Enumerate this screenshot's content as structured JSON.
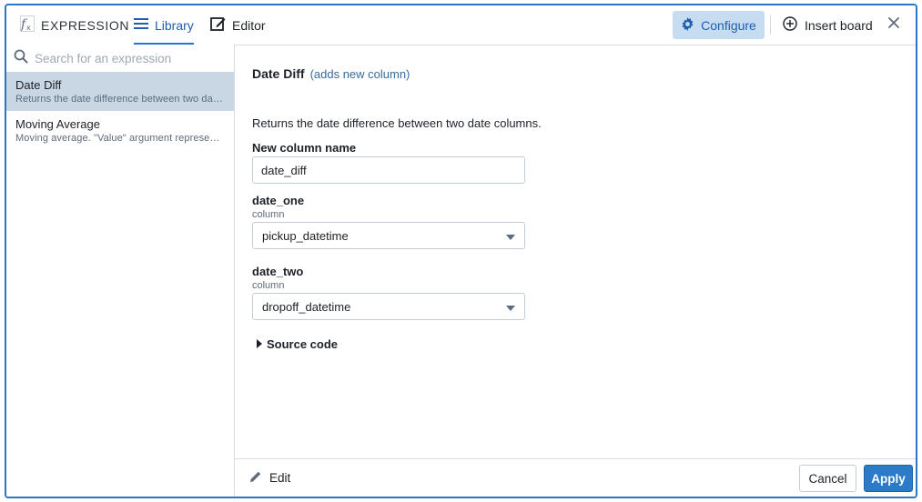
{
  "tabs": {
    "expression": "EXPRESSION",
    "library": "Library",
    "editor": "Editor"
  },
  "toolbar": {
    "configure": "Configure",
    "insert_board": "Insert board"
  },
  "sidebar": {
    "search_placeholder": "Search for an expression",
    "items": [
      {
        "name": "Date Diff",
        "description": "Returns the date difference between two date columns."
      },
      {
        "name": "Moving Average",
        "description": "Moving average. \"Value\" argument represents the column to average."
      }
    ]
  },
  "detail": {
    "title": "Date Diff",
    "subtitle": "(adds new column)",
    "description": "Returns the date difference between two date columns.",
    "new_column_label": "New column name",
    "new_column_value": "date_diff",
    "date_one": {
      "label": "date_one",
      "sub": "column",
      "value": "pickup_datetime"
    },
    "date_two": {
      "label": "date_two",
      "sub": "column",
      "value": "dropoff_datetime"
    },
    "source_code": "Source code"
  },
  "footer": {
    "edit": "Edit",
    "cancel": "Cancel",
    "apply": "Apply"
  },
  "colors": {
    "accent": "#2b78c2",
    "configure_bg": "#c6dcf0",
    "selected_item_bg": "#c9d6e3",
    "apply_bg": "#2b7bc8"
  }
}
